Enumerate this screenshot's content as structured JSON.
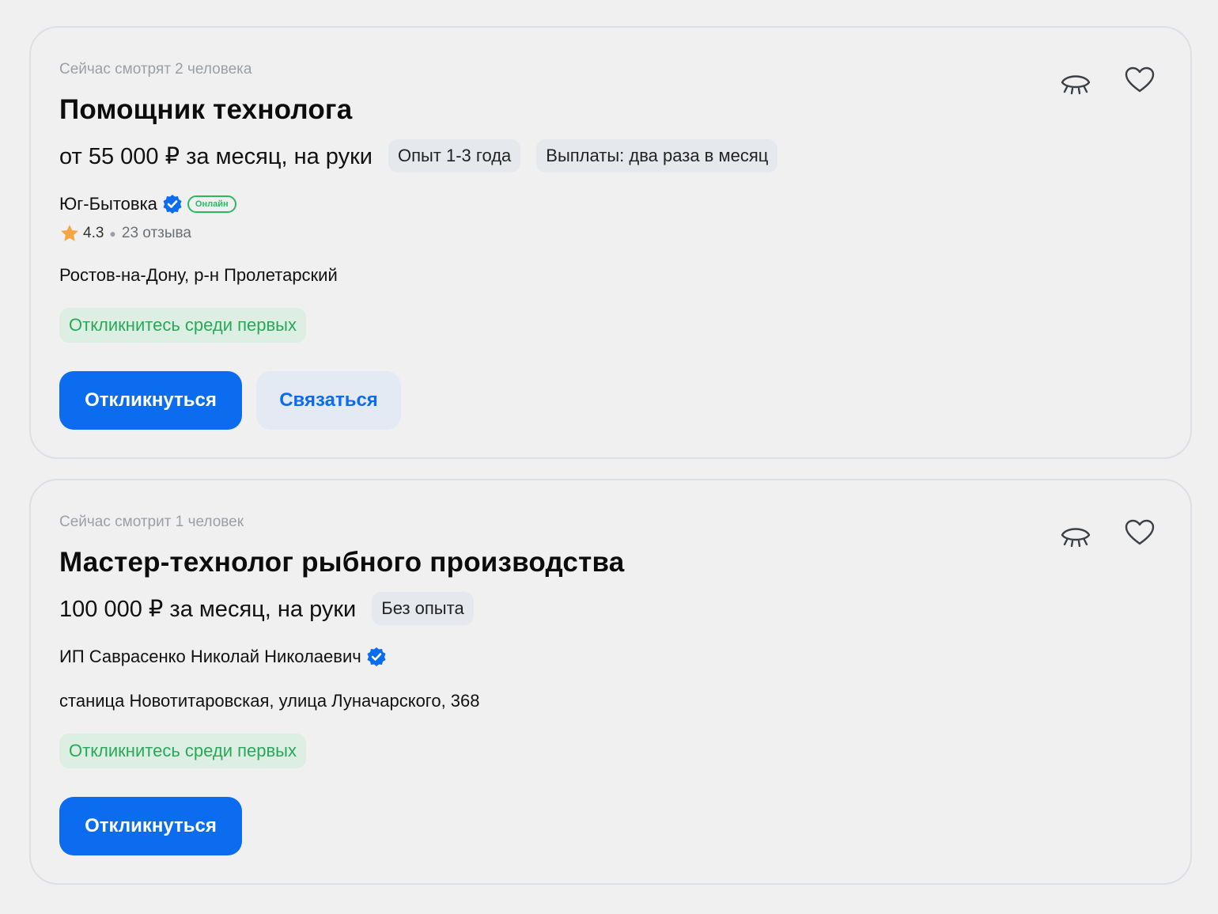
{
  "vacancies": [
    {
      "viewers": "Сейчас смотрят 2 человека",
      "title": "Помощник технолога",
      "salary": "от 55 000 ₽ за месяц, на руки",
      "tags": [
        "Опыт 1-3 года",
        "Выплаты: два раза в месяц"
      ],
      "company": "Юг-Бытовка",
      "online_badge": "Онлайн",
      "rating": "4.3",
      "reviews": "23 отзыва",
      "address": "Ростов-на-Дону, р-н Пролетарский",
      "first_badge": "Откликнитесь среди первых",
      "respond_label": "Откликнуться",
      "contact_label": "Связаться"
    },
    {
      "viewers": "Сейчас смотрит 1 человек",
      "title": "Мастер-технолог рыбного производства",
      "salary": "100 000 ₽ за месяц, на руки",
      "tags": [
        "Без опыта"
      ],
      "company": "ИП Саврасенко Николай Николаевич",
      "address": "станица Новотитаровская, улица Луначарского, 368",
      "first_badge": "Откликнитесь среди первых",
      "respond_label": "Откликнуться"
    }
  ],
  "icons": {
    "hide": "eye-closed-icon",
    "favorite": "heart-icon",
    "verified": "verified-check-icon",
    "star": "star-icon"
  },
  "colors": {
    "accent": "#0b6cf0",
    "success": "#29a85a",
    "success_bg": "#dcefe2",
    "star": "#f4a640",
    "chip_bg": "#e5e8ec",
    "background": "#f1f0f0"
  }
}
